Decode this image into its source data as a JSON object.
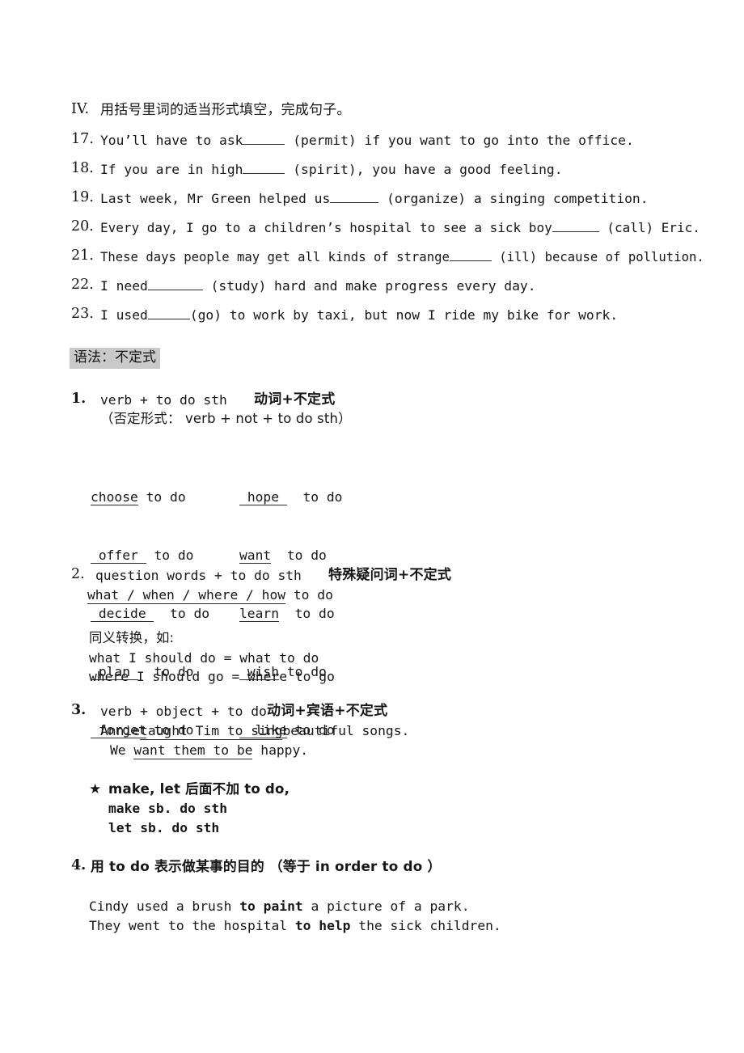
{
  "section_iv": {
    "marker": "IV.",
    "instruction": "用括号里词的适当形式填空，完成句子。",
    "questions": [
      {
        "number": "17.",
        "before": "You’ll have to ask",
        "blank_width": 52,
        "after": " (permit) if you want to go into the office."
      },
      {
        "number": "18.",
        "before": "If you are in high",
        "blank_width": 52,
        "after": " (spirit), you have a good feeling."
      },
      {
        "number": "19.",
        "before": "Last week, Mr Green helped us",
        "blank_width": 60,
        "after": " (organize) a singing competition."
      },
      {
        "number": "20.",
        "before": "Every day, I go to a children’s hospital to see a sick boy",
        "blank_width": 60,
        "after": " (call) Eric."
      },
      {
        "number": "21.",
        "before": "These days people may get all kinds of strange",
        "blank_width": 52,
        "after": " (ill) because of pollution."
      },
      {
        "number": "22.",
        "before": "I need",
        "blank_width": 68,
        "after": " (study) hard and make progress every day."
      },
      {
        "number": "23.",
        "before": "I used",
        "blank_width": 52,
        "after": "(go) to work by taxi, but now I ride my bike for work."
      }
    ]
  },
  "grammar": {
    "heading": "语法：不定式",
    "rule1": {
      "number": "1.",
      "pattern": "verb + to do sth",
      "cn_label": "动词+不定式",
      "negative": "（否定形式： verb + not + to do sth）",
      "verbs_left": [
        {
          "word": "choose",
          "lead": "",
          "trail": "",
          "rest": " to do"
        },
        {
          "word": "offer",
          "lead": " ",
          "trail": " ",
          "rest": " to do"
        },
        {
          "word": "decide",
          "lead": " ",
          "trail": " ",
          "rest": "  to do"
        },
        {
          "word": "plan",
          "lead": " ",
          "trail": " ",
          "rest": "  to do"
        },
        {
          "word": "forget",
          "lead": " ",
          "trail": "",
          "rest": " to do"
        }
      ],
      "verbs_right": [
        {
          "word": "hope",
          "lead": " ",
          "trail": " ",
          "rest": "  to do"
        },
        {
          "word": "want",
          "lead": "",
          "trail": "",
          "rest": "  to do"
        },
        {
          "word": "learn",
          "lead": "",
          "trail": "",
          "rest": "  to do"
        },
        {
          "word": "wish",
          "lead": " ",
          "trail": "",
          "rest": " to do"
        },
        {
          "word": "like",
          "lead": "  ",
          "trail": "",
          "rest": " to do"
        }
      ]
    },
    "rule2": {
      "number": "2.",
      "pattern": "question words + to do sth",
      "cn_label": "特殊疑问词+不定式",
      "forms_underlined": "what / when / where / how",
      "forms_tail": " to do",
      "equiv_title": "同义转换，如:",
      "equivalents": [
        "what I should do = what to do",
        "where I should go = where to go"
      ]
    },
    "rule3": {
      "number": "3.",
      "pattern": "verb + object + to do",
      "cn_label": "动词+宾语+不定式",
      "examples": [
        {
          "pre": "Annie",
          "mid": "taught Tim to sing",
          "post": "beautiful songs."
        },
        {
          "pre": "We ",
          "mid": "want them to be",
          "post": " happy."
        }
      ],
      "note": {
        "star": "★",
        "line1": "make, let 后面不加 to do,",
        "line2": "make sb. do sth",
        "line3": "let sb. do sth"
      }
    },
    "rule4": {
      "number": "4.",
      "title": "用 to do 表示做某事的目的 （等于 in order to do ）",
      "examples": [
        {
          "pre": "Cindy used a brush ",
          "mid": "to paint",
          "post": " a picture of a park."
        },
        {
          "pre": "They went to the hospital ",
          "mid": "to help",
          "post": " the sick children."
        }
      ]
    }
  }
}
